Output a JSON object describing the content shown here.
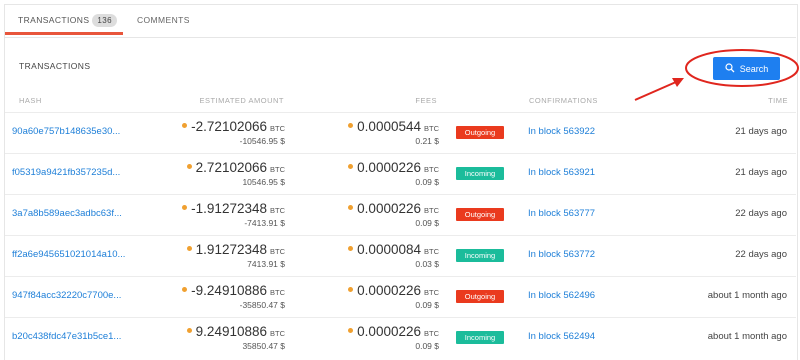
{
  "tabs": [
    {
      "label": "TRANSACTIONS",
      "count": "136"
    },
    {
      "label": "COMMENTS"
    }
  ],
  "section_title": "TRANSACTIONS",
  "search_label": "Search",
  "headers": {
    "hash": "HASH",
    "amount": "ESTIMATED AMOUNT",
    "fees": "FEES",
    "confirmations": "CONFIRMATIONS",
    "time": "TIME"
  },
  "colors": {
    "accent": "#1e7ff0",
    "outgoing": "#ea3a1e",
    "incoming": "#1bbc9b",
    "annotation": "#e0261e"
  },
  "rows": [
    {
      "hash": "90a60e757b148635e30...",
      "amount": "-2.72102066",
      "unit": "BTC",
      "usd": "-10546.95 $",
      "fee": "0.0000544",
      "fee_unit": "BTC",
      "fee_usd": "0.21 $",
      "direction": "Outgoing",
      "block": "In block 563922",
      "time": "21 days ago"
    },
    {
      "hash": "f05319a9421fb357235d...",
      "amount": "2.72102066",
      "unit": "BTC",
      "usd": "10546.95 $",
      "fee": "0.0000226",
      "fee_unit": "BTC",
      "fee_usd": "0.09 $",
      "direction": "Incoming",
      "block": "In block 563921",
      "time": "21 days ago"
    },
    {
      "hash": "3a7a8b589aec3adbc63f...",
      "amount": "-1.91272348",
      "unit": "BTC",
      "usd": "-7413.91 $",
      "fee": "0.0000226",
      "fee_unit": "BTC",
      "fee_usd": "0.09 $",
      "direction": "Outgoing",
      "block": "In block 563777",
      "time": "22 days ago"
    },
    {
      "hash": "ff2a6e945651021014a10...",
      "amount": "1.91272348",
      "unit": "BTC",
      "usd": "7413.91 $",
      "fee": "0.0000084",
      "fee_unit": "BTC",
      "fee_usd": "0.03 $",
      "direction": "Incoming",
      "block": "In block 563772",
      "time": "22 days ago"
    },
    {
      "hash": "947f84acc32220c7700e...",
      "amount": "-9.24910886",
      "unit": "BTC",
      "usd": "-35850.47 $",
      "fee": "0.0000226",
      "fee_unit": "BTC",
      "fee_usd": "0.09 $",
      "direction": "Outgoing",
      "block": "In block 562496",
      "time": "about 1 month ago"
    },
    {
      "hash": "b20c438fdc47e31b5ce1...",
      "amount": "9.24910886",
      "unit": "BTC",
      "usd": "35850.47 $",
      "fee": "0.0000226",
      "fee_unit": "BTC",
      "fee_usd": "0.09 $",
      "direction": "Incoming",
      "block": "In block 562494",
      "time": "about 1 month ago"
    }
  ]
}
